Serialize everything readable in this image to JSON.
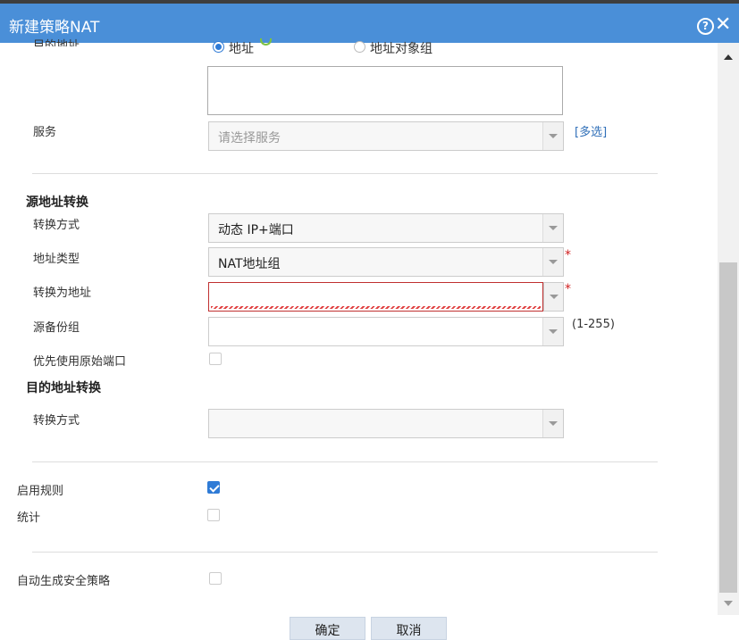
{
  "dialog": {
    "title": "新建策略NAT",
    "help_glyph": "?",
    "close_glyph": "✕"
  },
  "dest_address": {
    "label": "目的地址",
    "radio_address": "地址",
    "radio_group": "地址对象组"
  },
  "service": {
    "label": "服务",
    "placeholder": "请选择服务",
    "multi_link": "[多选]"
  },
  "source_nat": {
    "heading": "源地址转换",
    "method_label": "转换方式",
    "method_value": "动态 IP+端口",
    "addr_type_label": "地址类型",
    "addr_type_value": "NAT地址组",
    "translate_to_label": "转换为地址",
    "translate_to_value": "",
    "backup_group_label": "源备份组",
    "backup_group_value": "",
    "backup_range": "(1-255)",
    "prefer_port_label": "优先使用原始端口",
    "required_mark": "*"
  },
  "dest_nat": {
    "heading": "目的地址转换",
    "method_label": "转换方式",
    "method_value": ""
  },
  "options": {
    "enable_rule_label": "启用规则",
    "stats_label": "统计",
    "auto_policy_label": "自动生成安全策略"
  },
  "buttons": {
    "ok": "确定",
    "cancel": "取消"
  }
}
